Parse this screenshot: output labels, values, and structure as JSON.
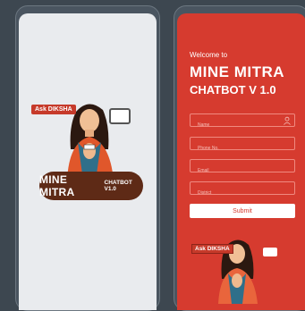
{
  "splash": {
    "ask_label": "Ask DIKSHA",
    "logo_main": "MINE MITRA",
    "logo_sub": "CHATBOT V1.0"
  },
  "login": {
    "welcome": "Welcome to",
    "brand_line1": "MINE MITRA",
    "brand_line2": "CHATBOT V 1.0",
    "fields": {
      "name_placeholder": "Name",
      "phone_placeholder": "Phone No.",
      "email_placeholder": "Email",
      "district_placeholder": "District"
    },
    "submit_label": "Submit",
    "ask_label": "Ask DIKSHA"
  },
  "colors": {
    "accent_red": "#d63b2f",
    "logo_brown": "#5e2a16",
    "splash_bg": "#e9ebee"
  }
}
